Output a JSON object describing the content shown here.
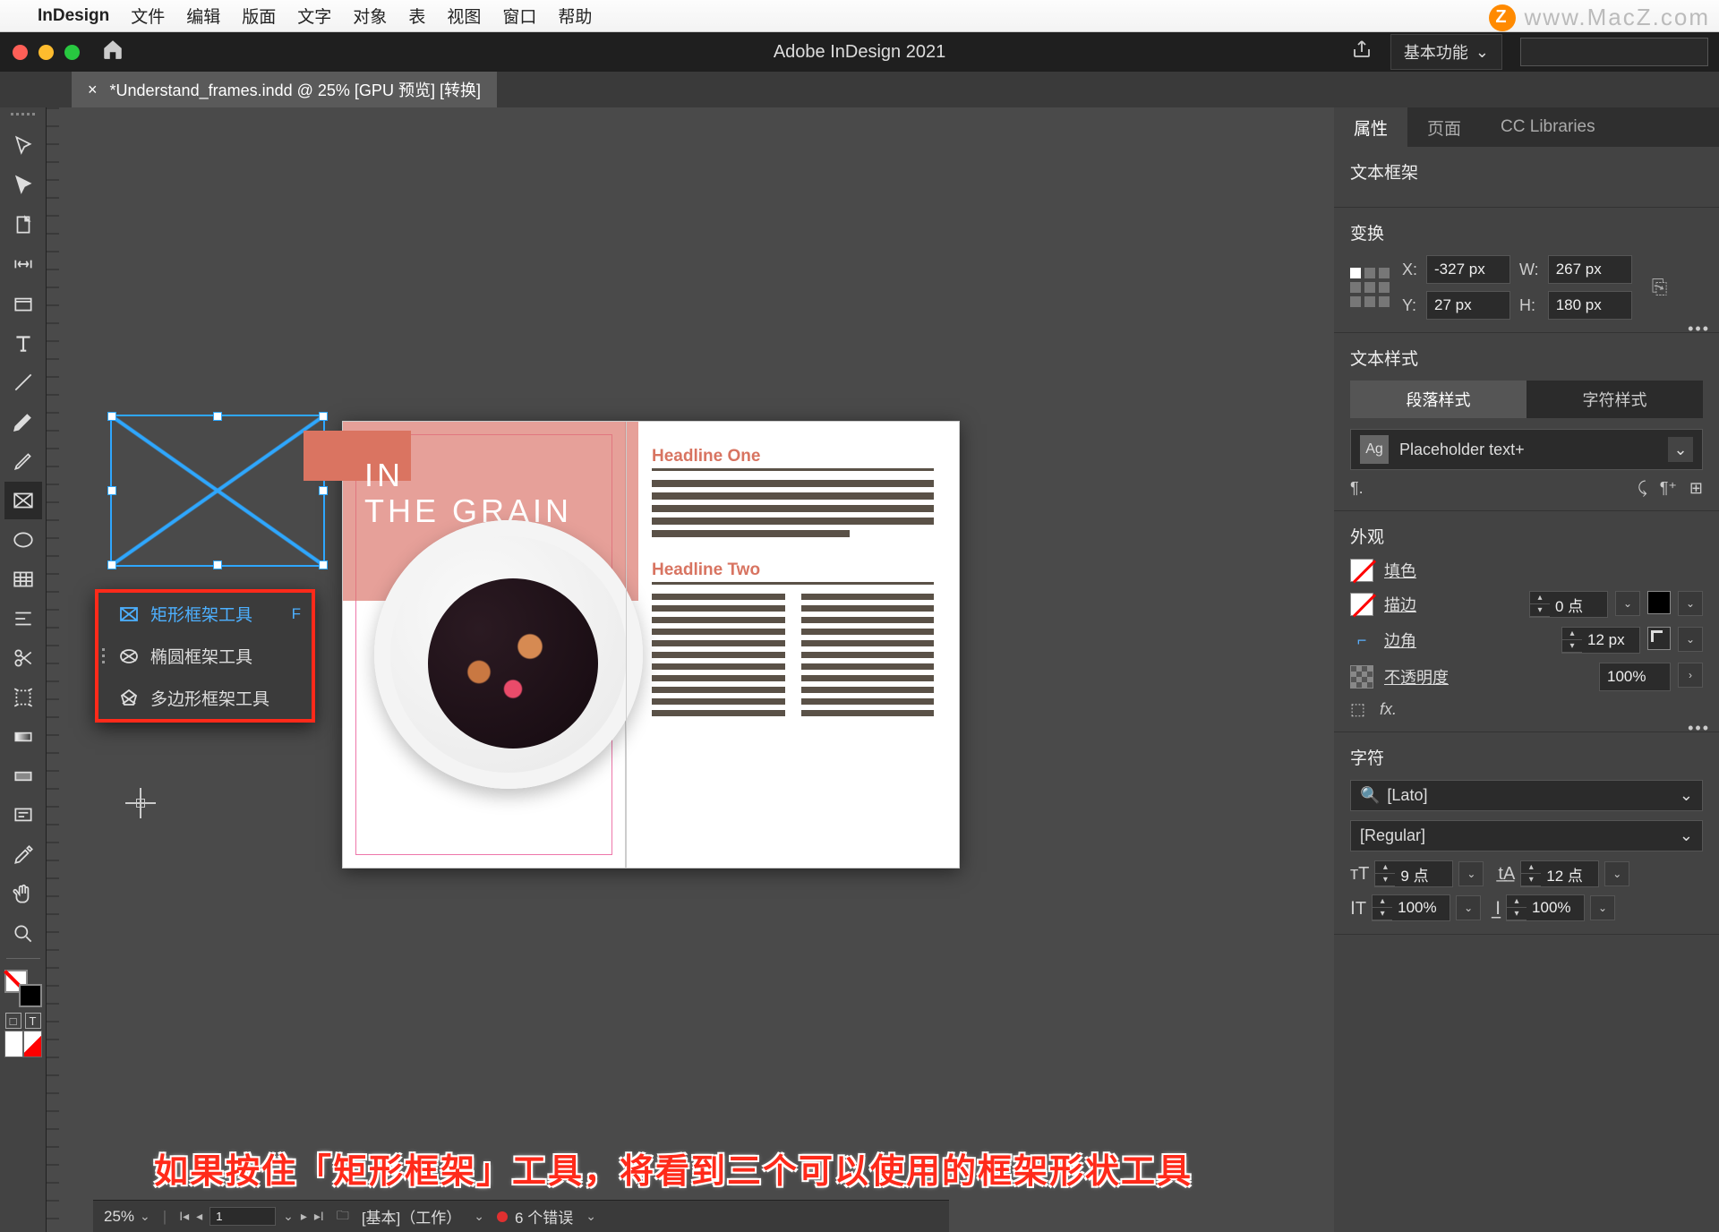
{
  "mac_menu": {
    "apple": "",
    "app": "InDesign",
    "items": [
      "文件",
      "编辑",
      "版面",
      "文字",
      "对象",
      "表",
      "视图",
      "窗口",
      "帮助"
    ]
  },
  "watermark": "www.MacZ.com",
  "titlebar": {
    "title": "Adobe InDesign 2021",
    "workspace": "基本功能"
  },
  "doc_tab": {
    "close": "×",
    "label": "*Understand_frames.indd @ 25% [GPU 预览] [转换]"
  },
  "flyout": {
    "items": [
      {
        "label": "矩形框架工具",
        "shortcut": "F",
        "selected": true,
        "icon": "rect-frame"
      },
      {
        "label": "椭圆框架工具",
        "shortcut": "",
        "selected": false,
        "icon": "ellipse-frame"
      },
      {
        "label": "多边形框架工具",
        "shortcut": "",
        "selected": false,
        "icon": "poly-frame"
      }
    ]
  },
  "spread": {
    "hero_line1": "IN",
    "hero_line2": "THE GRAIN",
    "headline1": "Headline One",
    "headline2": "Headline Two"
  },
  "panels": {
    "tabs": [
      "属性",
      "页面",
      "CC Libraries"
    ],
    "active_tab": 0,
    "frame_type": "文本框架",
    "transform": {
      "title": "变换",
      "x_label": "X:",
      "x": "-327 px",
      "y_label": "Y:",
      "y": "27 px",
      "w_label": "W:",
      "w": "267 px",
      "h_label": "H:",
      "h": "180 px"
    },
    "text_style": {
      "title": "文本样式",
      "tabs": [
        "段落样式",
        "字符样式"
      ],
      "placeholder_style": "Placeholder text+",
      "ag": "Ag",
      "pilcrow": "¶."
    },
    "appearance": {
      "title": "外观",
      "fill": "填色",
      "stroke": "描边",
      "stroke_val": "0 点",
      "corner": "边角",
      "corner_val": "12 px",
      "opacity": "不透明度",
      "opacity_val": "100%"
    },
    "character": {
      "title": "字符",
      "font": "[Lato]",
      "style": "[Regular]",
      "size": "9 点",
      "leading": "12 点",
      "tracking": "100%",
      "scale": "100%"
    }
  },
  "statusbar": {
    "zoom": "25%",
    "page": "1",
    "preflight": "[基本]（工作）",
    "errors": "6 个错误"
  },
  "caption": "如果按住「矩形框架」工具，将看到三个可以使用的框架形状工具"
}
